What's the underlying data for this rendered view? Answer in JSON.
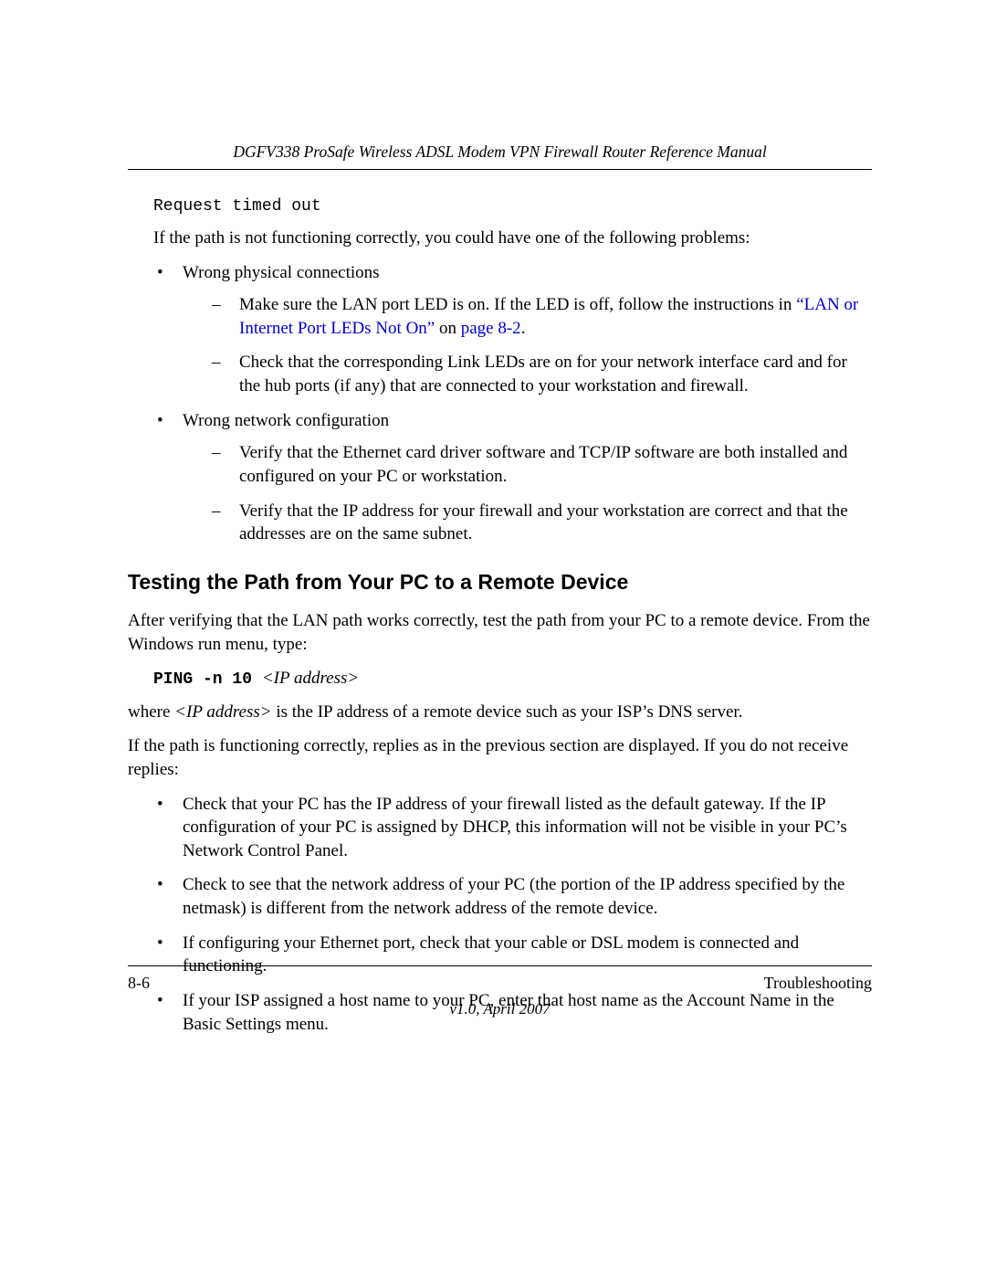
{
  "header": {
    "running": "DGFV338 ProSafe Wireless ADSL Modem VPN Firewall Router Reference Manual"
  },
  "body": {
    "timeout_msg": "Request timed out",
    "intro_path": "If the path is not functioning correctly, you could have one of the following problems:",
    "bullets1": {
      "b1": "Wrong physical connections",
      "b1_d1_a": "Make sure the LAN port LED is on. If the LED is off, follow the instructions in ",
      "b1_d1_link": "“LAN or Internet Port LEDs Not On”",
      "b1_d1_b": " on ",
      "b1_d1_page": "page 8-2",
      "b1_d1_c": ".",
      "b1_d2": "Check that the corresponding Link LEDs are on for your network interface card and for the hub ports (if any) that are connected to your workstation and firewall.",
      "b2": "Wrong network configuration",
      "b2_d1": "Verify that the Ethernet card driver software and TCP/IP software are both installed and configured on your PC or workstation.",
      "b2_d2": "Verify that the IP address for your firewall and your workstation are correct and that the addresses are on the same subnet."
    },
    "section_title": "Testing the Path from Your PC to a Remote Device",
    "para_after_h2": "After verifying that the LAN path works correctly, test the path from your PC to a remote device. From the Windows run menu, type:",
    "cmd_bold": "PING -n 10 ",
    "cmd_italic": "<IP address>",
    "where_a": "where ",
    "where_italic": "<IP address>",
    "where_b": " is the IP address of a remote device such as your ISP’s DNS server.",
    "para_replies": "If the path is functioning correctly, replies as in the previous section are displayed. If you do not receive replies:",
    "bullets2": {
      "c1": "Check that your PC has the IP address of your firewall listed as the default gateway. If the IP configuration of your PC is assigned by DHCP, this information will not be visible in your PC’s Network Control Panel.",
      "c2": "Check to see that the network address of your PC (the portion of the IP address specified by the netmask) is different from the network address of the remote device.",
      "c3": "If configuring your Ethernet port, check that your cable or DSL modem is connected and functioning.",
      "c4": "If your ISP assigned a host name to your PC, enter that host name as the Account Name in the Basic Settings menu."
    }
  },
  "footer": {
    "page_num": "8-6",
    "chapter": "Troubleshooting",
    "version": "v1.0, April 2007"
  }
}
